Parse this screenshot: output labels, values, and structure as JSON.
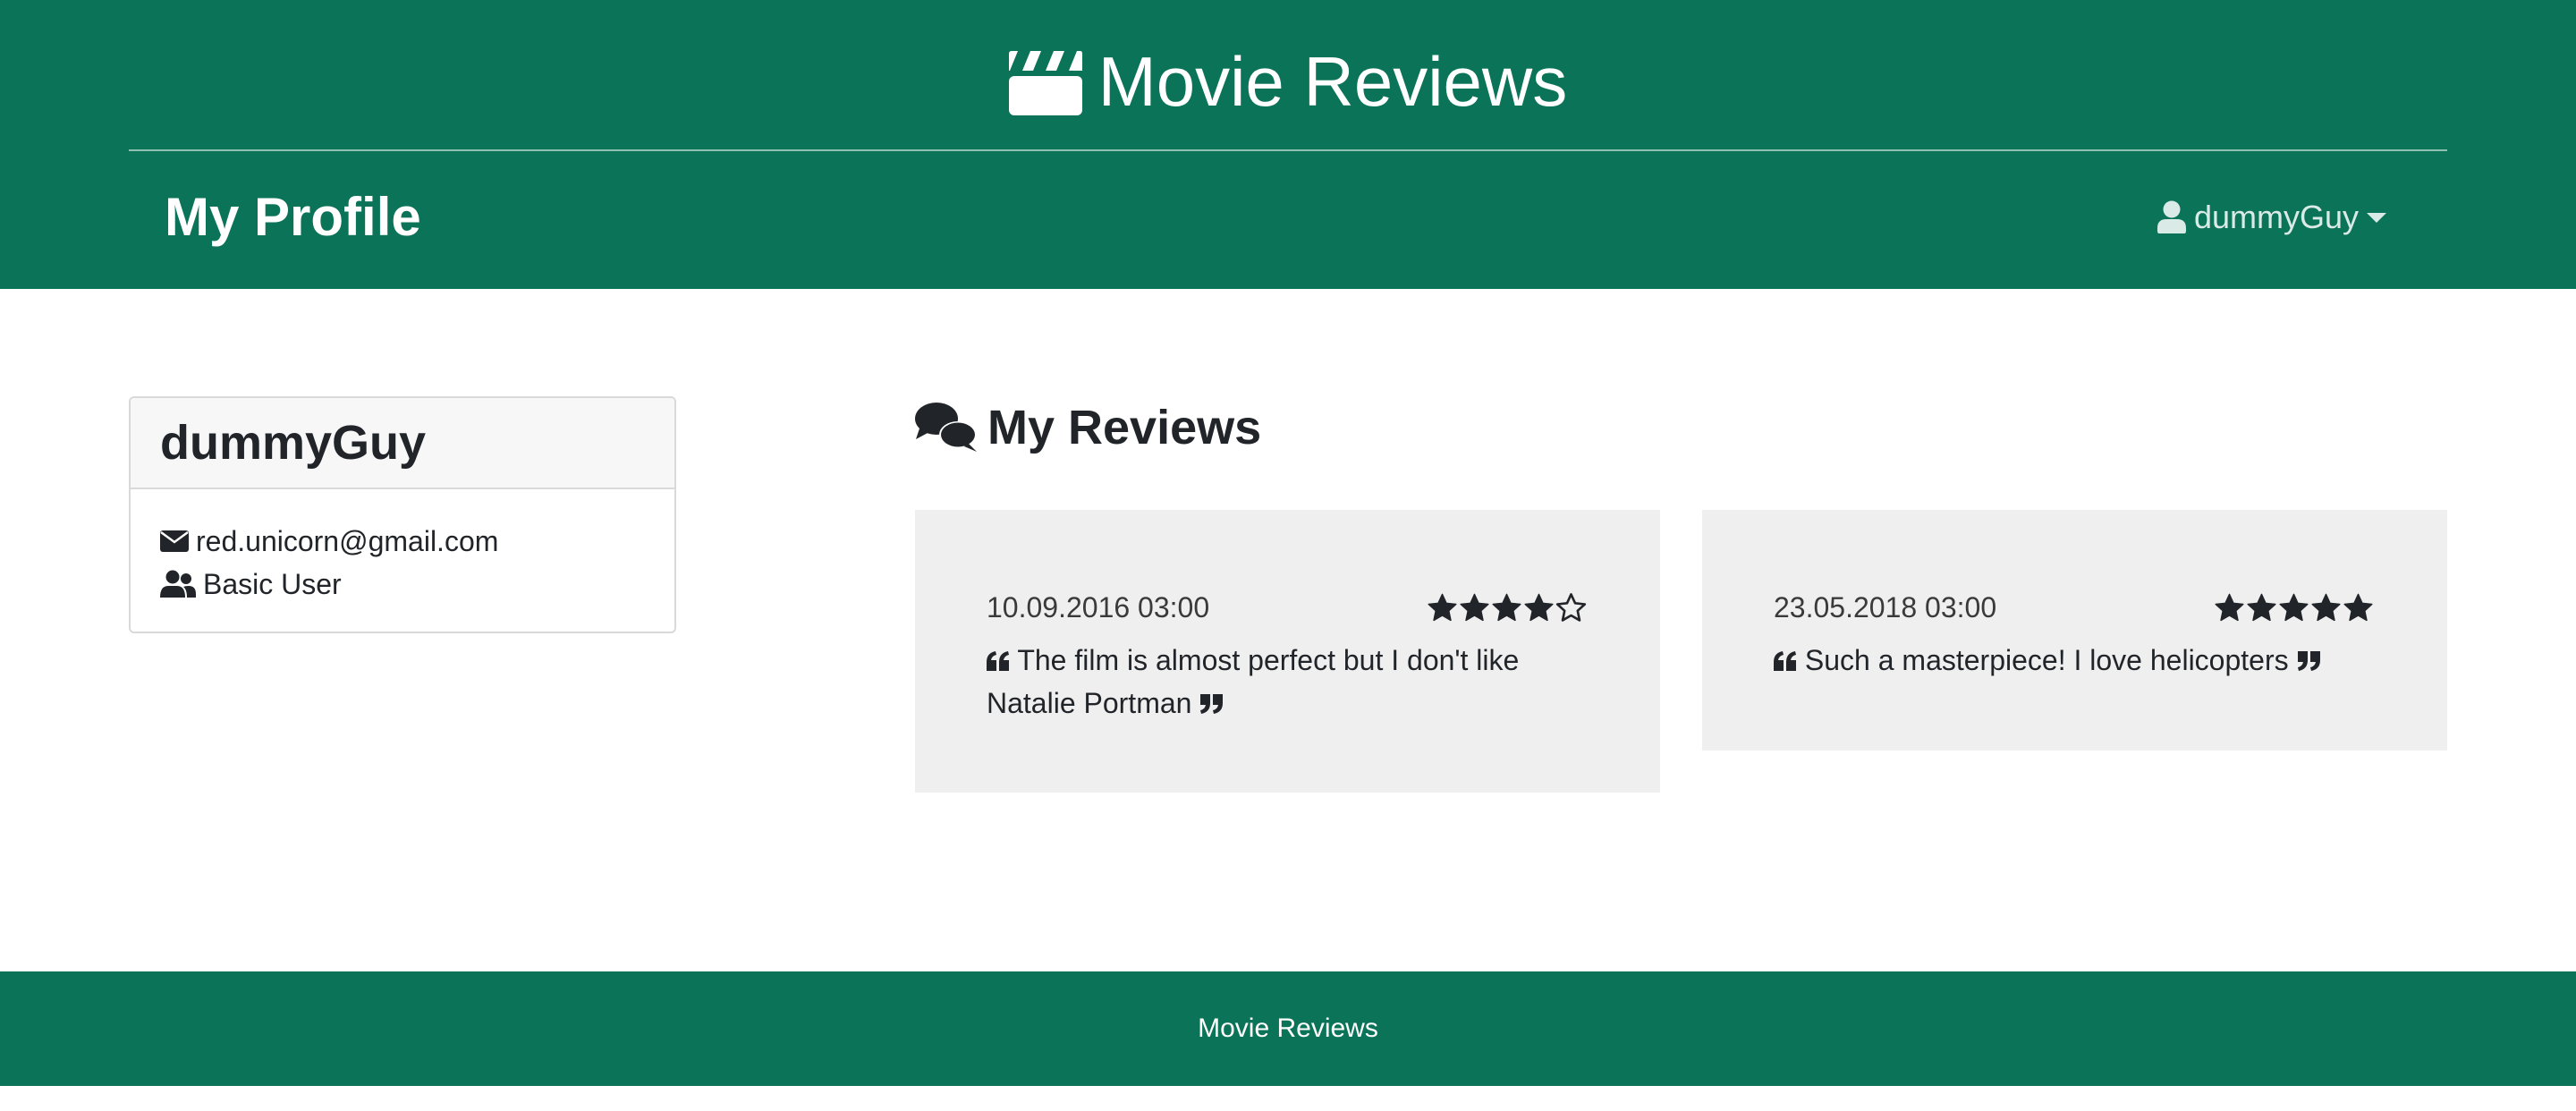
{
  "header": {
    "brand_icon": "clapperboard-icon",
    "brand_title": "Movie Reviews",
    "page_title": "My Profile",
    "user_menu": {
      "icon": "user-icon",
      "label": "dummyGuy"
    }
  },
  "profile": {
    "name": "dummyGuy",
    "email_icon": "envelope-icon",
    "email": "red.unicorn@gmail.com",
    "role_icon": "users-icon",
    "role": "Basic User"
  },
  "reviews": {
    "heading_icon": "comments-icon",
    "heading": "My Reviews",
    "items": [
      {
        "date": "10.09.2016 03:00",
        "rating": 4,
        "max_rating": 5,
        "text": "The film is almost perfect but I don't like Natalie Portman"
      },
      {
        "date": "23.05.2018 03:00",
        "rating": 5,
        "max_rating": 5,
        "text": "Such a masterpiece! I love helicopters"
      }
    ]
  },
  "footer": {
    "text": "Movie Reviews"
  },
  "colors": {
    "brand_green": "#0b7358",
    "card_gray": "#efefef",
    "text_dark": "#212529"
  }
}
